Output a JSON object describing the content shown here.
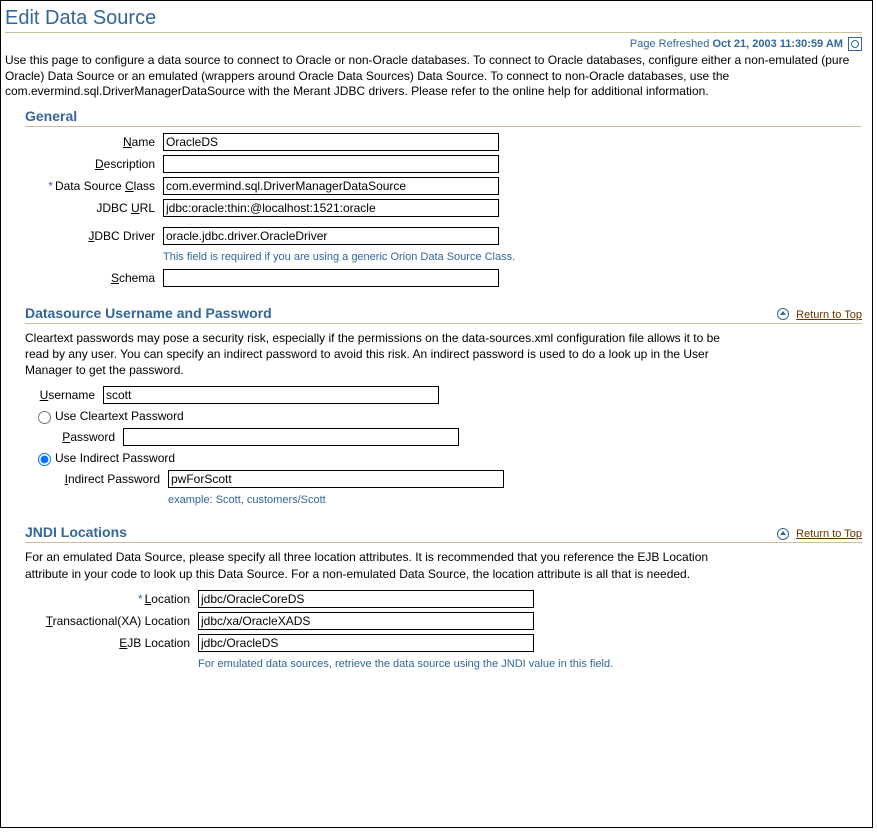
{
  "page": {
    "title": "Edit Data Source",
    "refreshed_label": "Page Refreshed",
    "refreshed_ts": "Oct 21, 2003 11:30:59 AM",
    "intro": "Use this page to configure a data source to connect to Oracle or non-Oracle databases. To connect to Oracle databases, configure either a non-emulated (pure Oracle) Data Source or an emulated (wrappers around Oracle Data Sources) Data Source. To connect to non-Oracle databases, use the com.evermind.sql.DriverManagerDataSource with the Merant JDBC drivers. Please refer to the online help for additional information.",
    "return_to_top": "Return to Top"
  },
  "general": {
    "header": "General",
    "name_label": "Name",
    "name_value": "OracleDS",
    "description_label": "Description",
    "description_value": "",
    "class_label": "Data Source Class",
    "class_value": "com.evermind.sql.DriverManagerDataSource",
    "jdbc_url_label": "JDBC URL",
    "jdbc_url_value": "jdbc:oracle:thin:@localhost:1521:oracle",
    "jdbc_driver_label": "JDBC Driver",
    "jdbc_driver_value": "oracle.jdbc.driver.OracleDriver",
    "jdbc_driver_hint": "This field is required if you are using a generic Orion Data Source Class.",
    "schema_label": "Schema",
    "schema_value": ""
  },
  "credentials": {
    "header": "Datasource Username and Password",
    "intro": "Cleartext passwords may pose a security risk, especially if the permissions on the data-sources.xml configuration file allows it to be read by any user. You can specify an indirect password to avoid this risk. An indirect password is used to do a look up in the User Manager to get the password.",
    "username_label": "Username",
    "username_value": "scott",
    "radio_cleartext_label": "Use Cleartext Password",
    "password_label": "Password",
    "password_value": "",
    "radio_indirect_label": "Use Indirect Password",
    "indirect_pw_label": "Indirect Password",
    "indirect_pw_value": "pwForScott",
    "indirect_pw_hint": "example: Scott, customers/Scott"
  },
  "jndi": {
    "header": "JNDI Locations",
    "intro": "For an emulated Data Source, please specify all three location attributes. It is recommended that you reference the EJB Location attribute in your code to look up this Data Source. For a non-emulated Data Source, the location attribute is all that is needed.",
    "location_label": "Location",
    "location_value": "jdbc/OracleCoreDS",
    "xa_location_label": "Transactional(XA) Location",
    "xa_location_value": "jdbc/xa/OracleXADS",
    "ejb_location_label": "EJB Location",
    "ejb_location_value": "jdbc/OracleDS",
    "hint": "For emulated data sources, retrieve the data source using the JNDI value in this field."
  }
}
